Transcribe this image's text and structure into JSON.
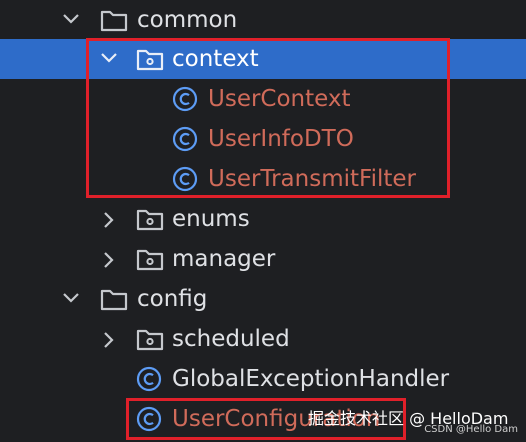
{
  "colors": {
    "background": "#1e1f22",
    "selection": "#2e6cc9",
    "text": "#dfe1e5",
    "vcs_modified_text": "#d06b5a",
    "class_icon": "#5d9cf5",
    "highlight_border": "#e0202a"
  },
  "tree": {
    "common": {
      "label": "common",
      "icon": "folder-icon",
      "expanded": true
    },
    "context": {
      "label": "context",
      "icon": "package-folder-icon",
      "expanded": true,
      "selected": true
    },
    "user_context": {
      "label": "UserContext",
      "icon": "class-icon"
    },
    "user_info_dto": {
      "label": "UserInfoDTO",
      "icon": "class-icon"
    },
    "user_transmit_filter": {
      "label": "UserTransmitFilter",
      "icon": "class-icon"
    },
    "enums": {
      "label": "enums",
      "icon": "package-folder-icon",
      "expanded": false
    },
    "manager": {
      "label": "manager",
      "icon": "package-folder-icon",
      "expanded": false
    },
    "config": {
      "label": "config",
      "icon": "folder-icon",
      "expanded": true
    },
    "scheduled": {
      "label": "scheduled",
      "icon": "package-folder-icon",
      "expanded": false
    },
    "global_exception_handler": {
      "label": "GlobalExceptionHandler",
      "icon": "class-icon"
    },
    "user_config": {
      "label": "UserConfiguration",
      "icon": "class-icon"
    }
  },
  "watermark": {
    "text": "掘金技术社区 @ HelloDam",
    "sub_text": "CSDN @Hello Dam"
  }
}
